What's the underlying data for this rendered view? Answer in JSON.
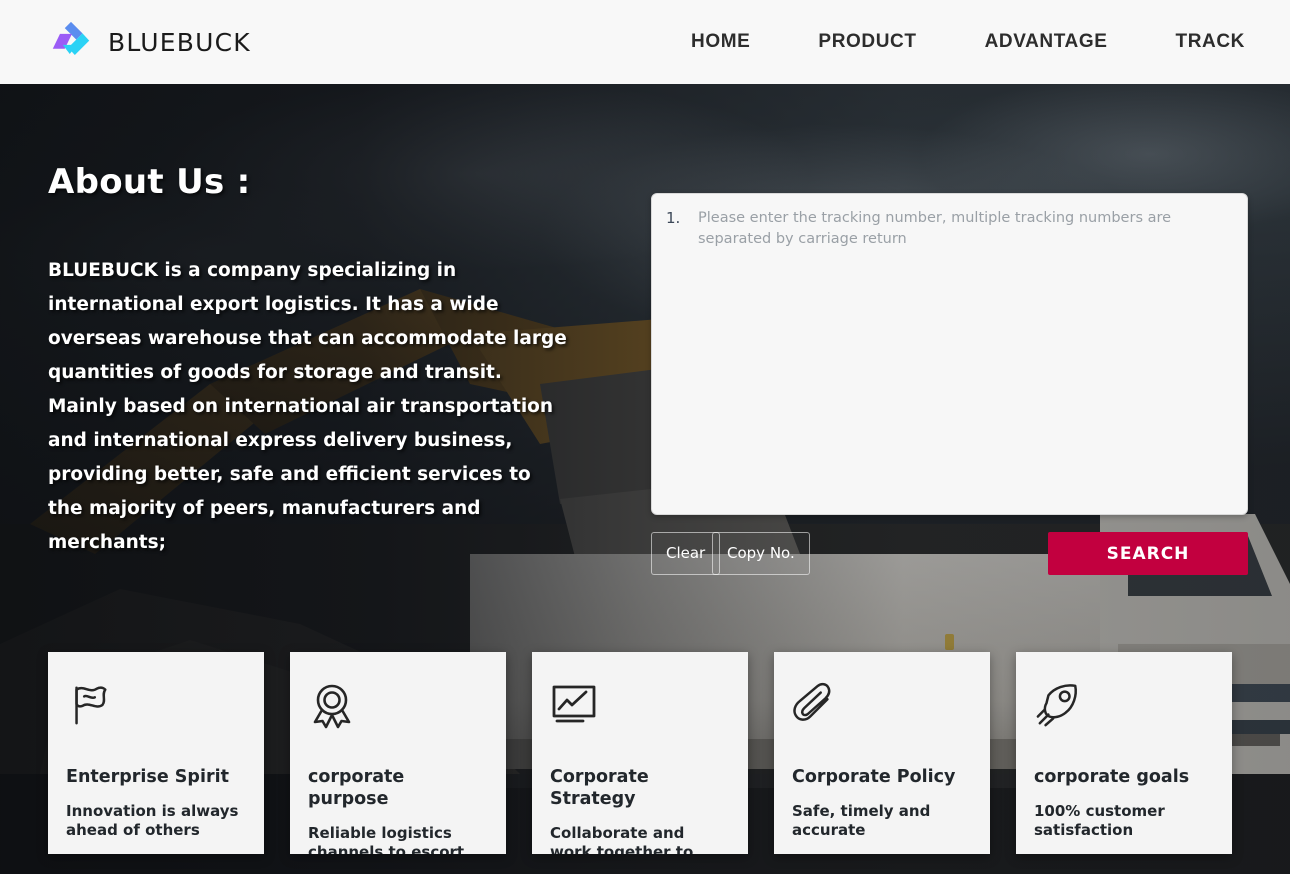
{
  "header": {
    "brand_name": "BLUEBUCK",
    "logo_icon": "bluebuck-triangle-logo",
    "nav": [
      {
        "label": "HOME",
        "name": "nav-home"
      },
      {
        "label": "PRODUCT",
        "name": "nav-product"
      },
      {
        "label": "ADVANTAGE",
        "name": "nav-advantage"
      },
      {
        "label": "TRACK",
        "name": "nav-track"
      }
    ]
  },
  "hero": {
    "about_title": "About Us :",
    "about_body": "BLUEBUCK is a company specializing in international export logistics. It has a wide overseas warehouse that can accommodate large quantities of goods for storage and transit. Mainly based on international air transportation and international express delivery business, providing better, safe and efficient services to the majority of peers, manufacturers and merchants;"
  },
  "tracking": {
    "line_number": "1.",
    "placeholder": "Please enter the tracking number, multiple tracking numbers are separated by carriage return",
    "value": "",
    "clear_label": "Clear",
    "copy_label": "Copy No.",
    "search_label": "SEARCH",
    "search_color": "#C2003F"
  },
  "cards": [
    {
      "icon": "flag-icon",
      "title": "Enterprise Spirit",
      "desc": "Innovation is always ahead of others"
    },
    {
      "icon": "award-medal-icon",
      "title": "corporate purpose",
      "desc": "Reliable logistics channels to escort peak seasons"
    },
    {
      "icon": "line-chart-board-icon",
      "title": "Corporate Strategy",
      "desc": "Collaborate and work together to reach new heights"
    },
    {
      "icon": "paperclip-icon",
      "title": "Corporate Policy",
      "desc": "Safe, timely and accurate"
    },
    {
      "icon": "rocket-icon",
      "title": "corporate goals",
      "desc": "100% customer satisfaction"
    }
  ]
}
